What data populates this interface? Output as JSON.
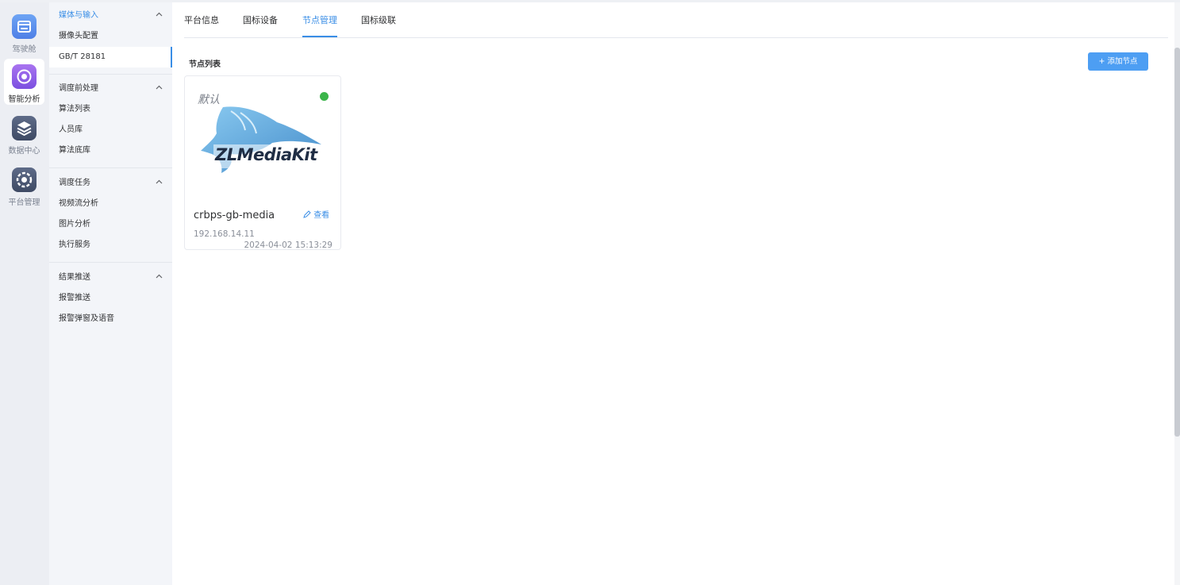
{
  "rail": {
    "items": [
      {
        "label": "驾驶舱",
        "icon": "cockpit-icon"
      },
      {
        "label": "智能分析",
        "icon": "ai-analysis-icon"
      },
      {
        "label": "数据中心",
        "icon": "data-center-icon"
      },
      {
        "label": "平台管理",
        "icon": "platform-settings-icon"
      }
    ]
  },
  "menu": {
    "groups": [
      {
        "title": "媒体与输入",
        "items": [
          "摄像头配置",
          "GB/T 28181"
        ]
      },
      {
        "title": "调度前处理",
        "items": [
          "算法列表",
          "人员库",
          "算法底库"
        ]
      },
      {
        "title": "调度任务",
        "items": [
          "视频流分析",
          "图片分析",
          "执行服务"
        ]
      },
      {
        "title": "结果推送",
        "items": [
          "报警推送",
          "报警弹窗及语音"
        ]
      }
    ],
    "selected_item": "GB/T 28181",
    "chevron": "^"
  },
  "tabs": [
    "平台信息",
    "国标设备",
    "节点管理",
    "国标级联"
  ],
  "active_tab": "节点管理",
  "section": {
    "title": "节点列表",
    "add_button": {
      "icon": "+",
      "label": "添加节点"
    }
  },
  "nodes": [
    {
      "tag": "默认",
      "status": "online",
      "logo_text": "ZLMediaKit",
      "name": "crbps-gb-media",
      "view_label": "查看",
      "view_icon": "edit-icon",
      "ip": "192.168.14.11",
      "time": "2024-04-02 15:13:29"
    }
  ],
  "colors": {
    "accent": "#3a8ee6",
    "button": "#4d9ef3",
    "online": "#3bb54a"
  }
}
